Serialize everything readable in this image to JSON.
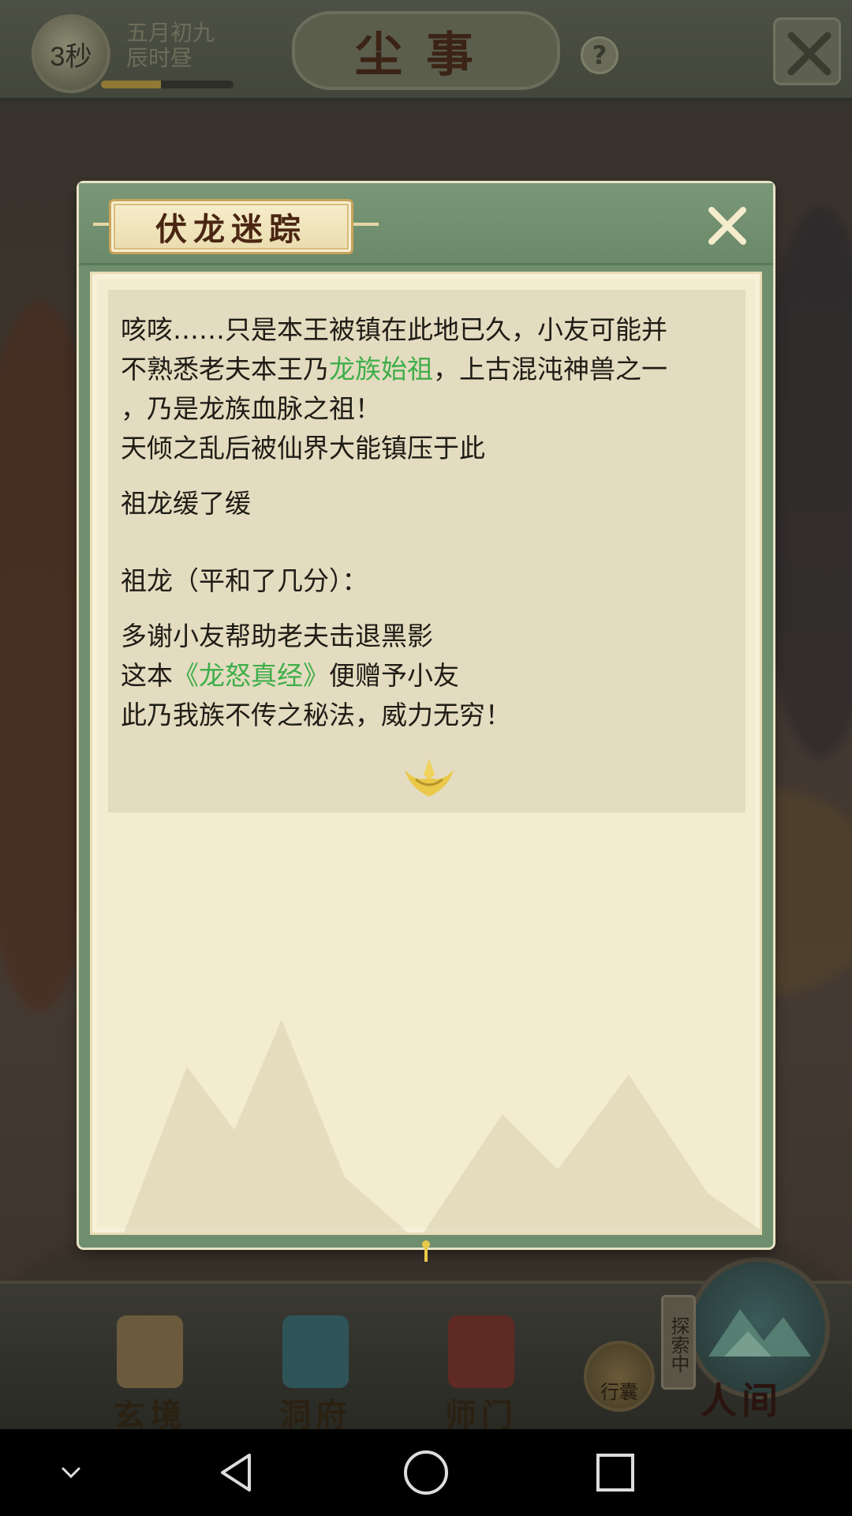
{
  "hud": {
    "timer": "3秒",
    "date_line1": "五月初九",
    "date_line2": "辰时昼",
    "progress": 0.45,
    "title": "尘事",
    "help": "?"
  },
  "dialog": {
    "title": "伏龙迷踪",
    "lines": {
      "l1": "咳咳……只是本王被镇在此地已久，小友可能并",
      "l2a": "不熟悉老夫本王乃",
      "l2b": "龙族始祖",
      "l2c": "，上古混沌神兽之一",
      "l3": "，乃是龙族血脉之祖！",
      "l4": "天倾之乱后被仙界大能镇压于此",
      "l5": "祖龙缓了缓",
      "l6": "祖龙（平和了几分）：",
      "l7": "多谢小友帮助老夫击退黑影",
      "l8a": "这本",
      "l8b": "《龙怒真经》",
      "l8c": "便赠予小友",
      "l9": "此乃我族不传之秘法，威力无穷！"
    },
    "highlight_color": "#3fae4a"
  },
  "nav": {
    "items": [
      {
        "label": "玄境"
      },
      {
        "label": "洞府"
      },
      {
        "label": "师门"
      }
    ],
    "bag_label": "行囊",
    "exploring_tag": "探索中",
    "world_label": "人间"
  },
  "system_bar": {
    "icons": [
      "chevron-down-icon",
      "back-icon",
      "home-icon",
      "recents-icon"
    ]
  }
}
